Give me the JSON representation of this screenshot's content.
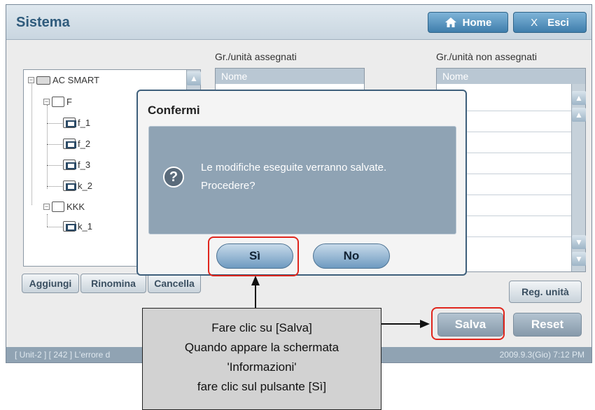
{
  "window": {
    "title": "Sistema"
  },
  "top_buttons": {
    "home": "Home",
    "esci_x": "X",
    "esci": "Esci"
  },
  "tree": {
    "root": "AC SMART",
    "nodes": [
      {
        "label": "F"
      },
      {
        "label": "f_1"
      },
      {
        "label": "f_2"
      },
      {
        "label": "f_3"
      },
      {
        "label": "k_2"
      },
      {
        "label": "KKK"
      },
      {
        "label": "k_1"
      }
    ]
  },
  "assigned": {
    "header": "Gr./unità assegnati",
    "column": "Nome"
  },
  "unassigned": {
    "header": "Gr./unità non assegnati",
    "column": "Nome"
  },
  "tree_buttons": {
    "add": "Aggiungi",
    "rename": "Rinomina",
    "delete": "Cancella"
  },
  "reg_button": "Reg. unità",
  "actions": {
    "save": "Salva",
    "reset": "Reset"
  },
  "status": {
    "left": "[ Unit-2 ] [ 242 ] L'errore d",
    "right": "2009.9.3(Gio)  7:12 PM"
  },
  "dialog": {
    "title": "Confermi",
    "message_line1": "Le modifiche eseguite verranno salvate.",
    "message_line2": "Procedere?",
    "yes": "Sì",
    "no": "No",
    "icon": "question-icon"
  },
  "callout": {
    "line1": "Fare clic su [Salva]",
    "line2": "Quando appare la schermata",
    "line3": "'Informazioni'",
    "line4": "fare clic sul pulsante [Sì]"
  },
  "colors": {
    "highlight": "#e0261d",
    "title": "#2f5b7c",
    "dialog_body": "#8fa3b4"
  }
}
